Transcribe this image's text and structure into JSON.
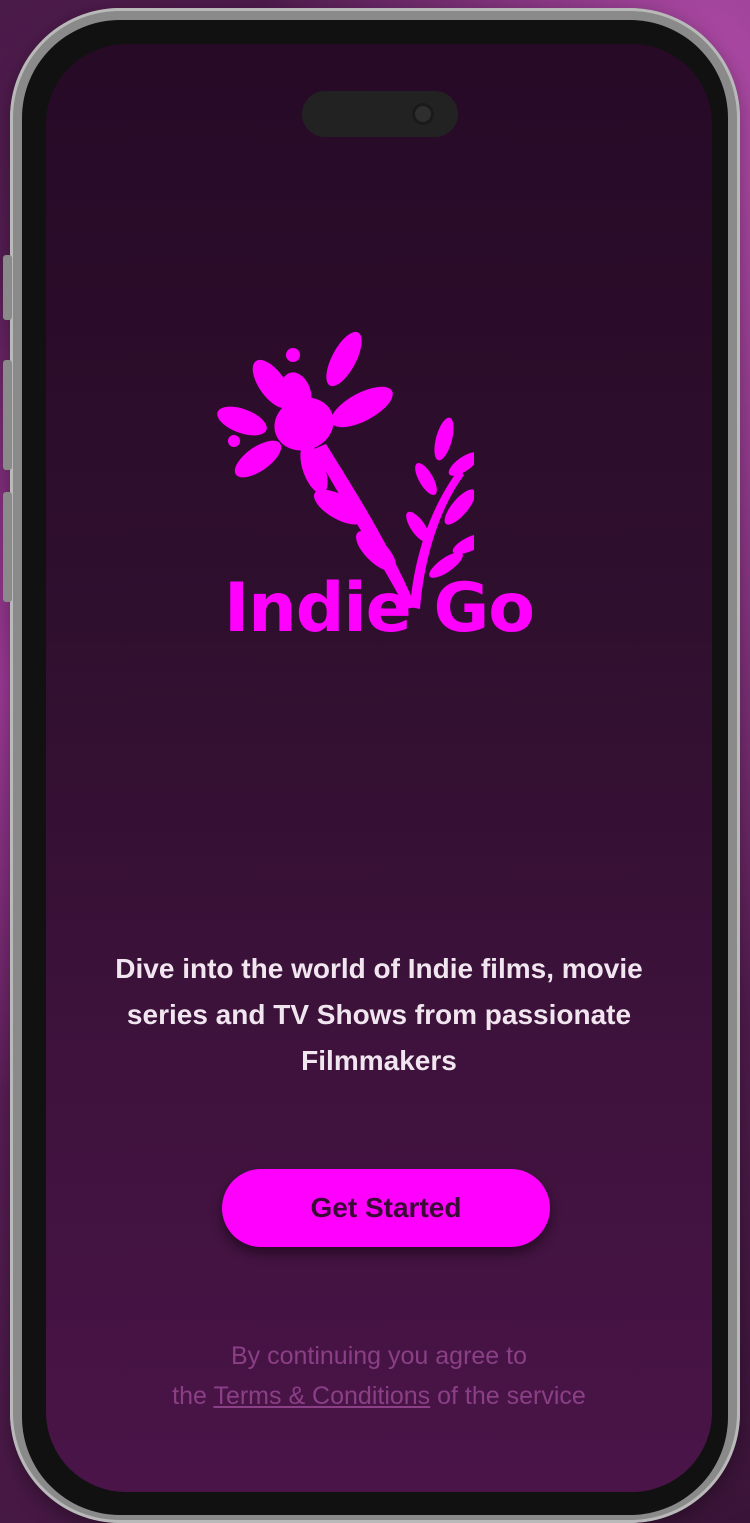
{
  "app": {
    "brand_name": "Indie Go",
    "tagline": "Dive into the world of Indie films, movie series and TV Shows from passionate Filmmakers",
    "cta_label": "Get Started",
    "legal": {
      "line1": "By continuing you agree to",
      "prefix": "the",
      "link_text": "Terms & Conditions",
      "suffix": "of the service"
    }
  },
  "colors": {
    "brand": "#ff00ff",
    "screen_top": "#260a26",
    "screen_bottom": "#4a1448",
    "tagline_text": "#f1e6ef",
    "legal_text": "#8a3f86"
  },
  "icons": {
    "logo": "flower-branch-icon"
  }
}
